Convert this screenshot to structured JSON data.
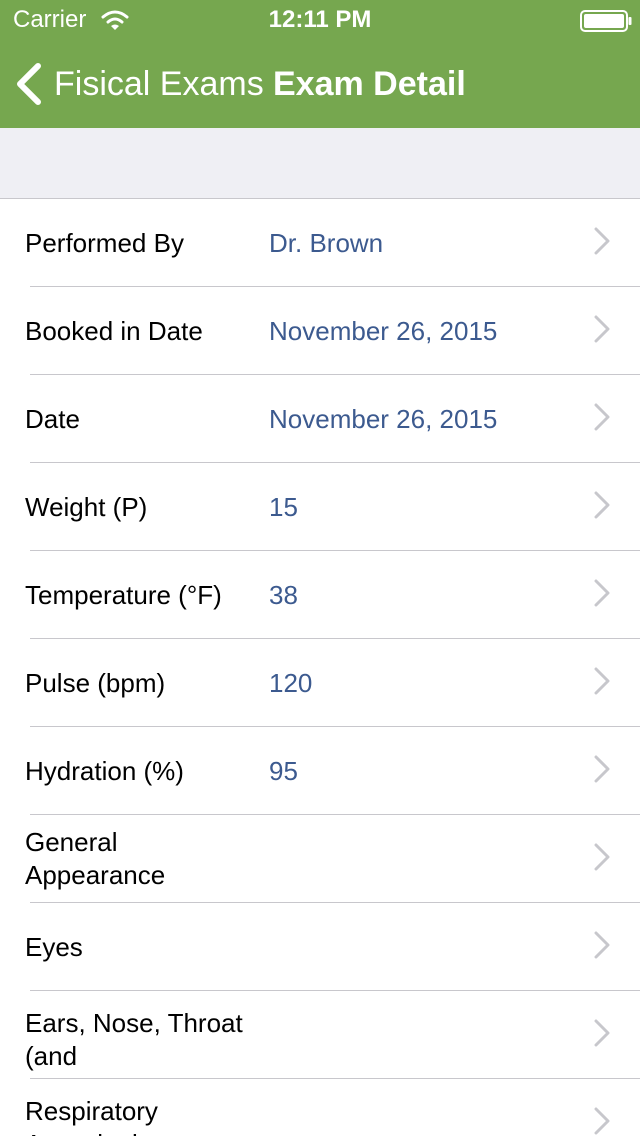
{
  "status_bar": {
    "carrier": "Carrier",
    "time": "12:11 PM",
    "icons": [
      "wifi-icon",
      "battery-icon"
    ]
  },
  "nav_bar": {
    "back_label": "Fisical Exams",
    "title": "Exam Detail",
    "background_color": "#76a74f"
  },
  "rows": [
    {
      "label": "Performed By",
      "value": "Dr. Brown"
    },
    {
      "label": "Booked in Date",
      "value": "November 26, 2015"
    },
    {
      "label": "Date",
      "value": "November 26, 2015"
    },
    {
      "label": "Weight (P)",
      "value": "15"
    },
    {
      "label": "Temperature (°F)",
      "value": "38"
    },
    {
      "label": "Pulse (bpm)",
      "value": "120"
    },
    {
      "label": "Hydration (%)",
      "value": "95"
    },
    {
      "label": "General Appearance",
      "value": ""
    },
    {
      "label": "Eyes",
      "value": ""
    },
    {
      "label": "Ears, Nose, Throat (and",
      "value": ""
    },
    {
      "label": "Respiratory Auscultation",
      "value": ""
    }
  ],
  "colors": {
    "value_text": "#3c5a8f",
    "section_background": "#efeff4",
    "chevron": "#c7c7cc"
  }
}
